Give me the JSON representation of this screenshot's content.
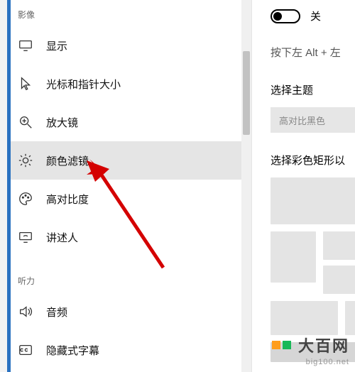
{
  "sidebar": {
    "category_visual": "影像",
    "category_audio": "听力",
    "items": [
      {
        "label": "显示"
      },
      {
        "label": "光标和指针大小"
      },
      {
        "label": "放大镜"
      },
      {
        "label": "颜色滤镜"
      },
      {
        "label": "高对比度"
      },
      {
        "label": "讲述人"
      }
    ],
    "audio_items": [
      {
        "label": "音频"
      },
      {
        "label": "隐藏式字幕"
      }
    ]
  },
  "right": {
    "toggle_state": "关",
    "shortcut_hint": "按下左 Alt + 左",
    "theme_heading": "选择主题",
    "theme_selected": "高对比黑色",
    "preview_heading": "选择彩色矩形以"
  },
  "watermark": {
    "cn": "大百网",
    "en": "big100.net"
  }
}
